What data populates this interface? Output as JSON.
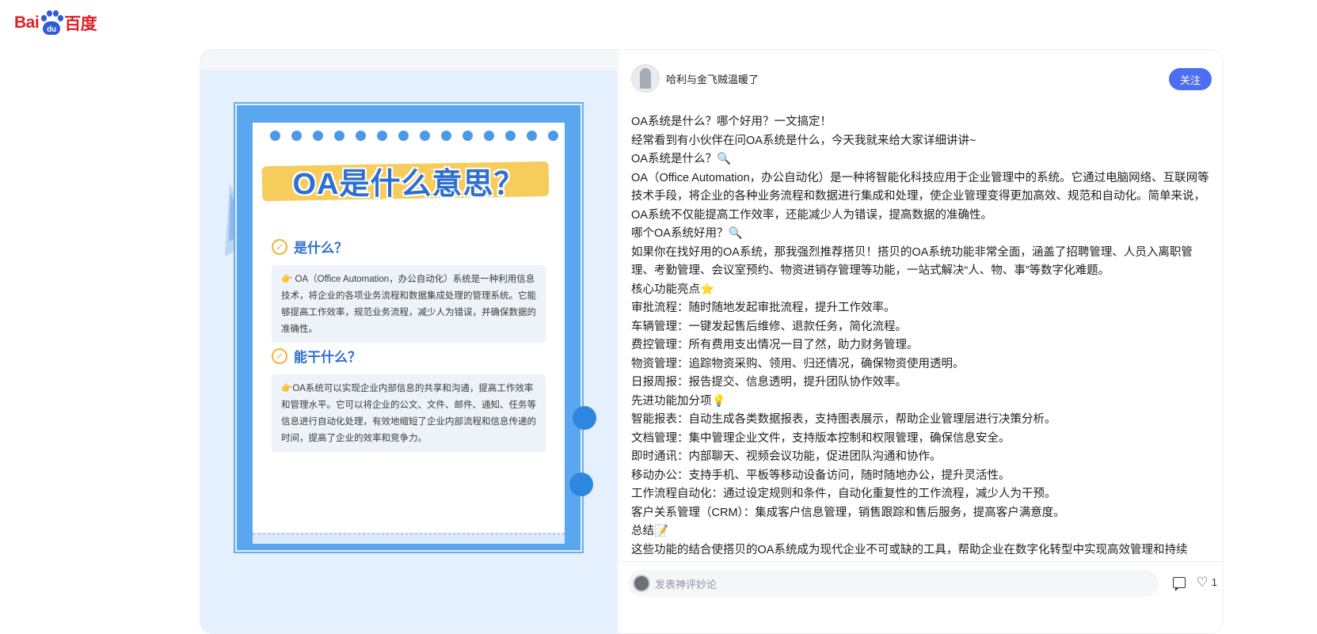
{
  "logo": {
    "part1": "Bai",
    "part2": "du",
    "part3": "百度"
  },
  "poster": {
    "title": "OA是什么意思？",
    "section1_heading": "是什么？",
    "section1_text": "👉 OA（Office Automation，办公自动化）系统是一种利用信息技术，将企业的各项业务流程和数据集成处理的管理系统。它能够提高工作效率，规范业务流程，减少人为错误，并确保数据的准确性。",
    "section2_heading": "能干什么？",
    "section2_text": "👉OA系统可以实现企业内部信息的共享和沟通，提高工作效率和管理水平。它可以将企业的公文、文件、邮件、通知、任务等信息进行自动化处理，有效地缩短了企业内部流程和信息传递的时间，提高了企业的效率和竞争力。"
  },
  "post": {
    "author": "哈利与金飞贼温暖了",
    "follow_label": "关注",
    "lines": [
      "OA系统是什么？哪个好用？一文搞定！",
      "经常看到有小伙伴在问OA系统是什么，今天我就来给大家详细讲讲~",
      "OA系统是什么？🔍",
      "OA（Office Automation，办公自动化）是一种将智能化科技应用于企业管理中的系统。它通过电脑网络、互联网等技术手段，将企业的各种业务流程和数据进行集成和处理，使企业管理变得更加高效、规范和自动化。简单来说，OA系统不仅能提高工作效率，还能减少人为错误，提高数据的准确性。",
      "哪个OA系统好用？🔍",
      "如果你在找好用的OA系统，那我强烈推荐搭贝！搭贝的OA系统功能非常全面，涵盖了招聘管理、人员入离职管理、考勤管理、会议室预约、物资进销存管理等功能，一站式解决“人、物、事”等数字化难题。",
      "核心功能亮点⭐",
      "审批流程：随时随地发起审批流程，提升工作效率。",
      "车辆管理：一键发起售后维修、退款任务，简化流程。",
      "费控管理：所有费用支出情况一目了然，助力财务管理。",
      "物资管理：追踪物资采购、领用、归还情况，确保物资使用透明。",
      "日报周报：报告提交、信息透明，提升团队协作效率。",
      "先进功能加分项💡",
      "智能报表：自动生成各类数据报表，支持图表展示，帮助企业管理层进行决策分析。",
      "文档管理：集中管理企业文件，支持版本控制和权限管理，确保信息安全。",
      "即时通讯：内部聊天、视频会议功能，促进团队沟通和协作。",
      "移动办公：支持手机、平板等移动设备访问，随时随地办公，提升灵活性。",
      "工作流程自动化：通过设定规则和条件，自动化重复性的工作流程，减少人为干预。",
      "客户关系管理（CRM）：集成客户信息管理，销售跟踪和售后服务，提高客户满意度。",
      "总结📝",
      "这些功能的结合使搭贝的OA系统成为现代企业不可或缺的工具，帮助企业在数字化转型中实现高效管理和持续"
    ]
  },
  "comment": {
    "placeholder": "发表神评妙论"
  },
  "like_count": "1",
  "colors": {
    "brand_red": "#de1f26",
    "brand_blue": "#2f5bd6",
    "follow_bg": "#4e6ef2"
  }
}
